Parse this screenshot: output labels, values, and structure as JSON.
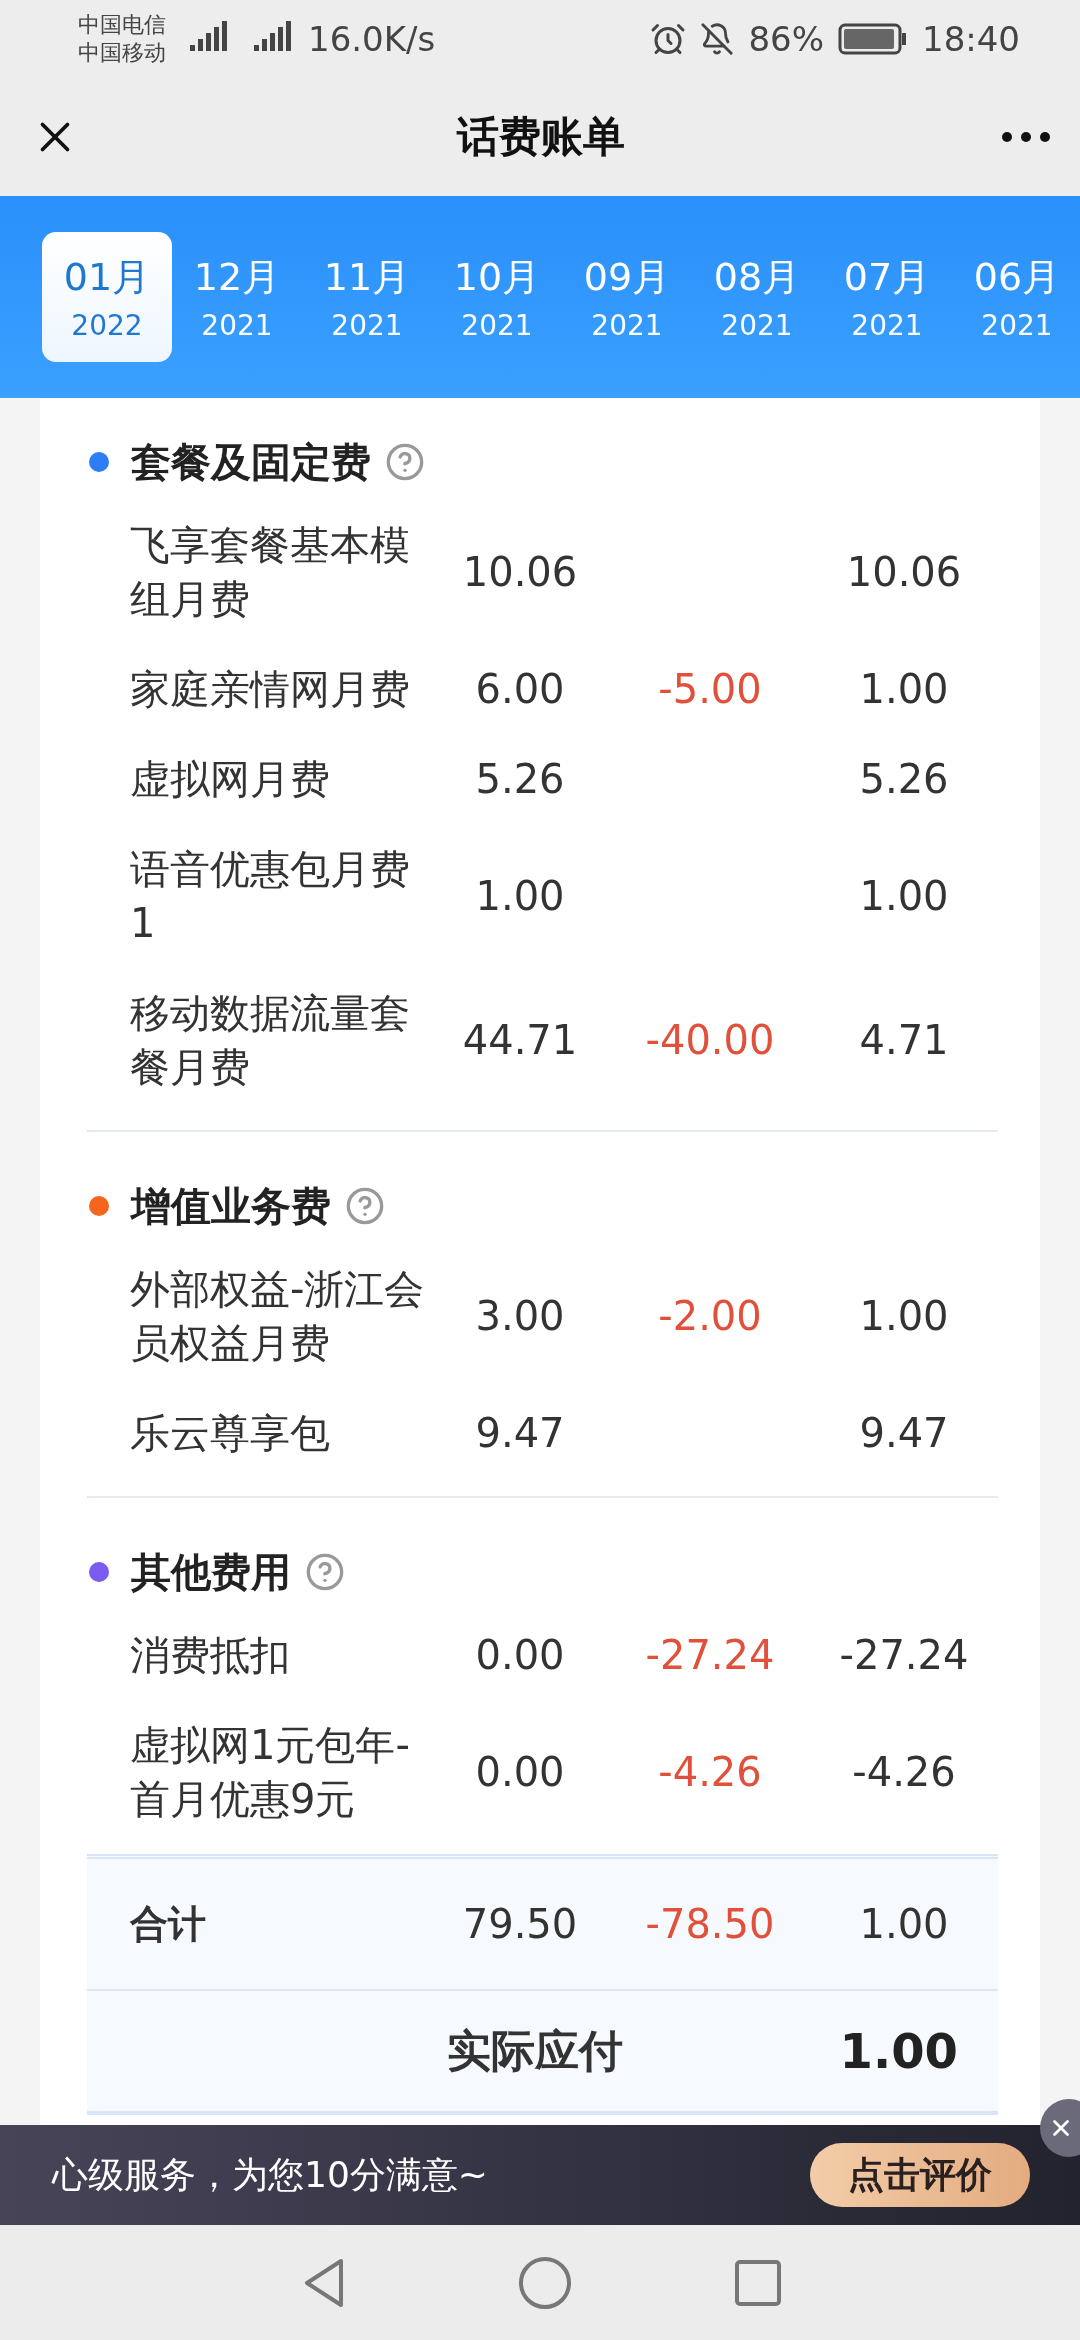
{
  "status_bar": {
    "carriers": [
      "中国电信",
      "中国移动"
    ],
    "speed": "16.0K/s",
    "battery": "86%",
    "time": "18:40"
  },
  "header": {
    "title": "话费账单"
  },
  "months": [
    {
      "month": "01月",
      "year": "2022",
      "selected": true
    },
    {
      "month": "12月",
      "year": "2021",
      "selected": false
    },
    {
      "month": "11月",
      "year": "2021",
      "selected": false
    },
    {
      "month": "10月",
      "year": "2021",
      "selected": false
    },
    {
      "month": "09月",
      "year": "2021",
      "selected": false
    },
    {
      "month": "08月",
      "year": "2021",
      "selected": false
    },
    {
      "month": "07月",
      "year": "2021",
      "selected": false
    },
    {
      "month": "06月",
      "year": "2021",
      "selected": false
    }
  ],
  "sections": [
    {
      "title": "套餐及固定费",
      "color": "#2f7df6",
      "rows": [
        {
          "name": "飞享套餐基本模组月费",
          "column_1": "10.06",
          "column_3": "10.06"
        },
        {
          "name": "家庭亲情网月费",
          "column_1": "6.00",
          "column_2": "-5.00",
          "column_3": "1.00"
        },
        {
          "name": "虚拟网月费",
          "column_1": "5.26",
          "column_3": "5.26"
        },
        {
          "name": "语音优惠包月费1",
          "column_1": "1.00",
          "column_3": "1.00"
        },
        {
          "name": "移动数据流量套餐月费",
          "column_1": "44.71",
          "column_2": "-40.00",
          "column_3": "4.71"
        }
      ]
    },
    {
      "title": "增值业务费",
      "color": "#f5651e",
      "rows": [
        {
          "name": "外部权益-浙江会员权益月费",
          "column_1": "3.00",
          "column_2": "-2.00",
          "column_3": "1.00"
        },
        {
          "name": "乐云尊享包",
          "column_1": "9.47",
          "column_3": "9.47"
        }
      ]
    },
    {
      "title": "其他费用",
      "color": "#7b5cf0",
      "rows": [
        {
          "name": "消费抵扣",
          "column_1": "0.00",
          "column_2": "-27.24",
          "column_3": "-27.24"
        },
        {
          "name": "虚拟网1元包年-首月优惠9元",
          "column_1": "0.00",
          "column_2": "-4.26",
          "column_3": "-4.26"
        }
      ]
    }
  ],
  "total": {
    "label": "合计",
    "column_1": "79.50",
    "column_2": "-78.50",
    "column_3": "1.00"
  },
  "payable": {
    "label": "实际应付",
    "value": "1.00"
  },
  "banner": {
    "text": "心级服务，为您10分满意~",
    "button": "点击评价"
  }
}
